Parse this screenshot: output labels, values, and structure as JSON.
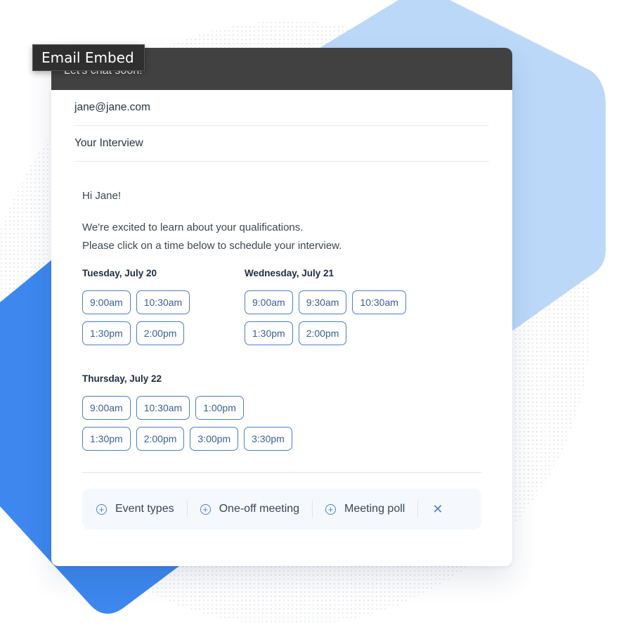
{
  "tooltip": {
    "label": "Email Embed"
  },
  "email": {
    "header_title": "Let's chat soon!",
    "to": "jane@jane.com",
    "subject": "Your Interview",
    "greeting": "Hi Jane!",
    "body_line1": "We're excited to learn about your qualifications.",
    "body_line2": "Please click on a time below to schedule your interview."
  },
  "days": [
    {
      "title": "Tuesday, July 20",
      "slots": [
        "9:00am",
        "10:30am",
        "1:30pm",
        "2:00pm"
      ]
    },
    {
      "title": "Wednesday, July 21",
      "slots": [
        "9:00am",
        "9:30am",
        "10:30am",
        "1:30pm",
        "2:00pm"
      ]
    },
    {
      "title": "Thursday, July 22",
      "slots": [
        "9:00am",
        "10:30am",
        "1:00pm",
        "1:30pm",
        "2:00pm",
        "3:00pm",
        "3:30pm"
      ]
    }
  ],
  "toolbar": {
    "items": [
      {
        "icon": "plus-circle-icon",
        "label": "Event types"
      },
      {
        "icon": "plus-circle-icon",
        "label": "One-off meeting"
      },
      {
        "icon": "plus-circle-icon",
        "label": "Meeting poll"
      }
    ],
    "close_icon": "close-icon"
  },
  "colors": {
    "header_bg": "#414141",
    "accent": "#4d7fc4",
    "bg_blue": "#3d87ee",
    "bg_light_blue": "#bcd8f8"
  }
}
